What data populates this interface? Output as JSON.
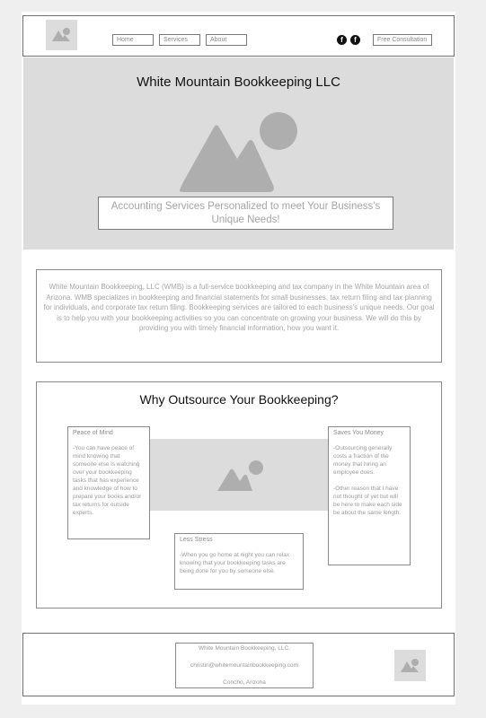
{
  "header": {
    "logo_icon": "image-placeholder-icon",
    "nav": [
      "Home",
      "Services",
      "About"
    ],
    "social_icons": [
      "facebook-icon",
      "facebook-icon"
    ],
    "cta_label": "Free Consultation"
  },
  "hero": {
    "title": "White Mountain Bookkeeping LLC",
    "image_icon": "mountain-image-placeholder-icon",
    "tagline": "Accounting Services Personalized to meet Your Business's Unique Needs!"
  },
  "intro": {
    "text": "White Mountain Bookkeeping, LLC (WMB) is a full-service bookkeeping and tax company in the White Mountain area of Arizona. WMB specializes in bookkeeping and financial statements for small businesses, tax return filing and tax planning for individuals, and corporate tax return filing. Bookkeeping services are tailored to each business's unique needs. Our goal is to help you with your bookkeeping activities so you can concentrate on growing your business. We will do this by providing you with timely financial information, how you want it."
  },
  "why": {
    "title": "Why Outsource Your Bookkeeping?",
    "cards": [
      {
        "title": "Peace of Mind",
        "body": "-You can have peace of mind knowing that someone else is watching over your bookkeeping tasks that has experience and knowledge of how to prepare your books and/or tax returns for outside experts."
      },
      {
        "title": "Saves You Money",
        "body": "-Outsourcing generally costs a fraction of the money that hiring an employee does.\n\n-Other reason that I have not thought of yet but will be here to make each side be about the same length."
      },
      {
        "title": "Less Stress",
        "body": "-When you go home at night you can relax knowing that your bookkeeping tasks are being done for you by someone else."
      }
    ],
    "image_icon": "image-placeholder-icon"
  },
  "footer": {
    "company": "White Mountain Bookkeeping, LLC.",
    "email": "christin@whitemountainbookkeeping.com",
    "location": "Concho, Arizona",
    "logo_icon": "image-placeholder-icon"
  },
  "colors": {
    "page_bg": "#efefef",
    "hero_bg": "#dcdcdc",
    "placeholder_gray": "#b5b5b5",
    "border": "#8a8a8a"
  }
}
